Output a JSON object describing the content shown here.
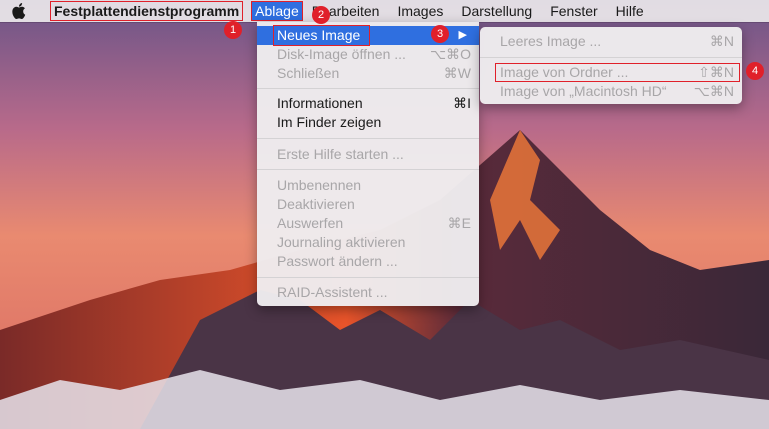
{
  "menubar": {
    "app_name": "Festplattendienstprogramm",
    "menus": [
      "Ablage",
      "Bearbeiten",
      "Images",
      "Darstellung",
      "Fenster",
      "Hilfe"
    ]
  },
  "ablage_menu": {
    "items": [
      {
        "label": "Neues Image",
        "shortcut": "▶"
      },
      {
        "label": "Disk-Image öffnen ...",
        "shortcut": "⌥⌘O"
      },
      {
        "label": "Schließen",
        "shortcut": "⌘W"
      },
      {
        "label": "Informationen",
        "shortcut": "⌘I"
      },
      {
        "label": "Im Finder zeigen",
        "shortcut": ""
      },
      {
        "label": "Erste Hilfe starten ...",
        "shortcut": ""
      },
      {
        "label": "Umbenennen",
        "shortcut": ""
      },
      {
        "label": "Deaktivieren",
        "shortcut": ""
      },
      {
        "label": "Auswerfen",
        "shortcut": "⌘E"
      },
      {
        "label": "Journaling aktivieren",
        "shortcut": ""
      },
      {
        "label": "Passwort ändern ...",
        "shortcut": ""
      },
      {
        "label": "RAID-Assistent ...",
        "shortcut": ""
      }
    ]
  },
  "neues_image_submenu": {
    "items": [
      {
        "label": "Leeres Image ...",
        "shortcut": "⌘N"
      },
      {
        "label": "Image von Ordner ...",
        "shortcut": "⇧⌘N"
      },
      {
        "label": "Image von „Macintosh HD“",
        "shortcut": "⌥⌘N"
      }
    ]
  },
  "badges": [
    "1",
    "2",
    "3",
    "4"
  ],
  "colors": {
    "highlight": "#2f6fe0",
    "annotation": "#e0202a"
  }
}
